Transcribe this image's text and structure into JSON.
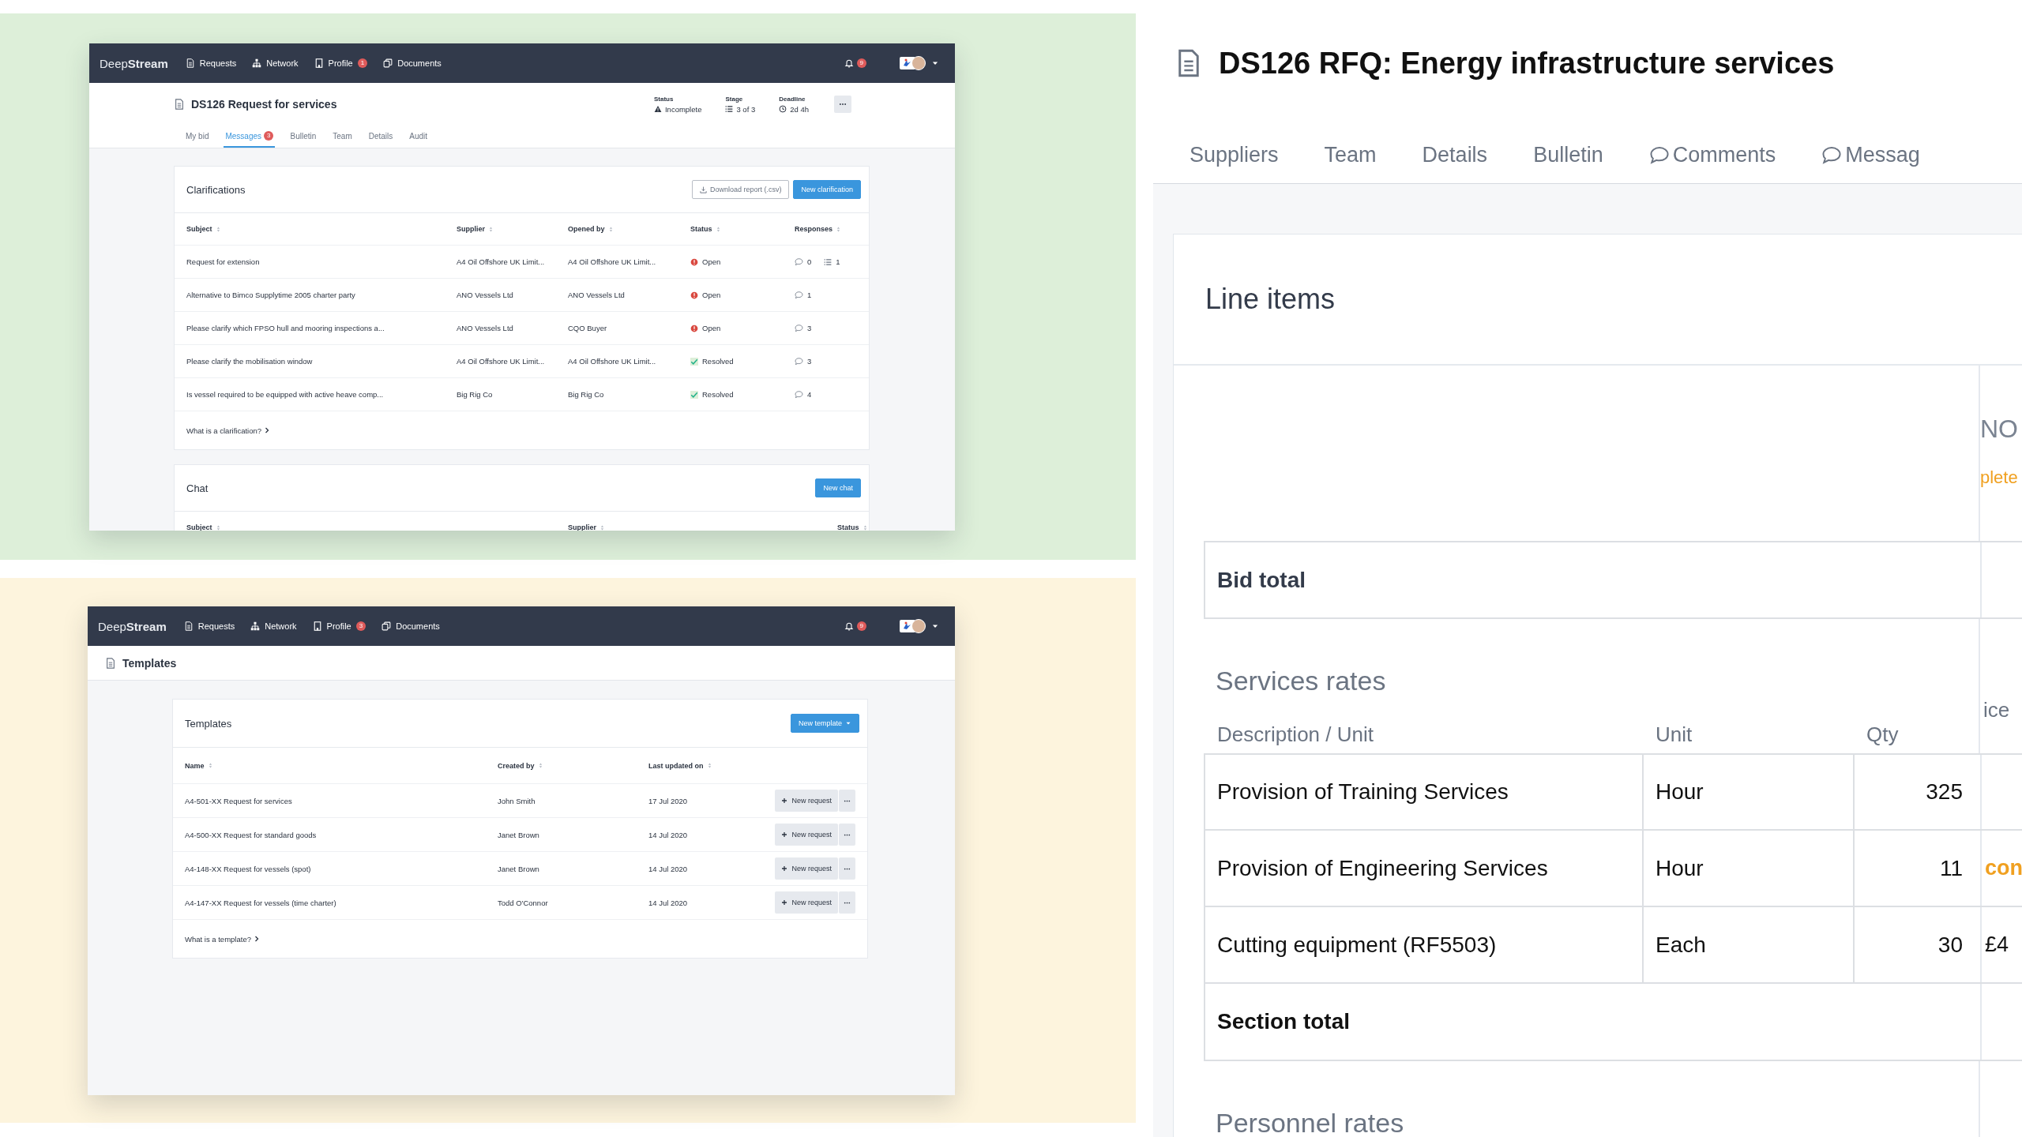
{
  "clarifications_screen": {
    "navbar": {
      "logo": "Deep**Stream**",
      "items": [
        {
          "label": "Requests"
        },
        {
          "label": "Network"
        },
        {
          "label": "Profile",
          "badge": "1"
        },
        {
          "label": "Documents"
        }
      ],
      "notifications_badge": "9"
    },
    "header": {
      "title": "DS126 Request for services",
      "meta": [
        {
          "label": "Status",
          "value": "Incomplete"
        },
        {
          "label": "Stage",
          "value": "3 of 3"
        },
        {
          "label": "Deadline",
          "value": "2d 4h"
        }
      ]
    },
    "tabs": [
      {
        "label": "My bid",
        "selected": false
      },
      {
        "label": "Messages",
        "badge": "3",
        "selected": true
      },
      {
        "label": "Bulletin",
        "selected": false
      },
      {
        "label": "Team",
        "selected": false
      },
      {
        "label": "Details",
        "selected": false
      },
      {
        "label": "Audit",
        "selected": false
      }
    ],
    "clarifications": {
      "title": "Clarifications",
      "buttons": [
        {
          "label": "Download report (.csv)",
          "kind": "secondary"
        },
        {
          "label": "New clarification",
          "kind": "primary"
        }
      ],
      "columns": [
        "Subject",
        "Supplier",
        "Opened by",
        "Status",
        "Responses"
      ],
      "rows": [
        {
          "subject": "Request for extension",
          "supplier": "A4 Oil Offshore UK Limit...",
          "opened_by": "A4 Oil Offshore UK Limit...",
          "status": "Open",
          "kind": "open",
          "comments": "0",
          "items": "1"
        },
        {
          "subject": "Alternative to Bimco Supplytime 2005 charter party",
          "supplier": "ANO Vessels Ltd",
          "opened_by": "ANO Vessels Ltd",
          "status": "Open",
          "kind": "open",
          "comments": "1"
        },
        {
          "subject": "Please clarify which FPSO hull and mooring inspections a...",
          "supplier": "ANO Vessels Ltd",
          "opened_by": "CQO Buyer",
          "status": "Open",
          "kind": "open",
          "comments": "3"
        },
        {
          "subject": "Please clarify the mobilisation window",
          "supplier": "A4 Oil Offshore UK Limit...",
          "opened_by": "A4 Oil Offshore UK Limit...",
          "status": "Resolved",
          "kind": "resolved",
          "comments": "3"
        },
        {
          "subject": "Is vessel required to be equipped with active heave comp...",
          "supplier": "Big Rig Co",
          "opened_by": "Big Rig Co",
          "status": "Resolved",
          "kind": "resolved",
          "comments": "4"
        }
      ],
      "help_link": "What is a clarification?"
    },
    "chat": {
      "title": "Chat",
      "button": "New chat",
      "columns": [
        "Subject",
        "Supplier",
        "Status"
      ]
    }
  },
  "templates_screen": {
    "navbar": {
      "logo": "Deep**Stream**",
      "items": [
        {
          "label": "Requests"
        },
        {
          "label": "Network"
        },
        {
          "label": "Profile",
          "badge": "3"
        },
        {
          "label": "Documents"
        }
      ],
      "notifications_badge": "9"
    },
    "header": {
      "title": "Templates"
    },
    "templates": {
      "title": "Templates",
      "button": "New template",
      "columns": [
        "Name",
        "Created by",
        "Last updated on"
      ],
      "rows": [
        {
          "name": "A4-501-XX Request for services",
          "created_by": "John Smith",
          "updated": "17 Jul 2020",
          "action": "New request"
        },
        {
          "name": "A4-500-XX Request for standard goods",
          "created_by": "Janet Brown",
          "updated": "14 Jul 2020",
          "action": "New request"
        },
        {
          "name": "A4-148-XX Request for vessels (spot)",
          "created_by": "Janet Brown",
          "updated": "14 Jul 2020",
          "action": "New request"
        },
        {
          "name": "A4-147-XX Request for vessels (time charter)",
          "created_by": "Todd O'Connor",
          "updated": "14 Jul 2020",
          "action": "New request"
        }
      ],
      "help_link": "What is a template?"
    }
  },
  "rfq_panel": {
    "title": "DS126 RFQ: Energy infrastructure services",
    "tabs": [
      {
        "label": "Suppliers",
        "kind": "plain"
      },
      {
        "label": "Team",
        "kind": "plain"
      },
      {
        "label": "Details",
        "kind": "plain"
      },
      {
        "label": "Bulletin",
        "kind": "plain"
      },
      {
        "label": "Comments",
        "kind": "chat"
      },
      {
        "label": "Messag",
        "kind": "chat"
      }
    ],
    "line_items": {
      "title": "Line items",
      "side_status": "NO",
      "side_note": "plete",
      "bid_total": "Bid total",
      "sections": [
        {
          "title": "Services rates",
          "columns": [
            "Description / Unit",
            "Unit",
            "Qty",
            "ice"
          ],
          "rows": [
            {
              "description": "Provision of Training Services",
              "unit": "Hour",
              "qty": "325"
            },
            {
              "description": "Provision of Engineering Services",
              "unit": "Hour",
              "qty": "11",
              "side": {
                "text": "con",
                "kind": "warning"
              }
            },
            {
              "description": "Cutting equipment (RF5503)",
              "unit": "Each",
              "qty": "30",
              "side": {
                "text": "£4",
                "kind": "value"
              }
            }
          ],
          "total": "Section total"
        },
        {
          "title": "Personnel rates"
        }
      ]
    }
  }
}
